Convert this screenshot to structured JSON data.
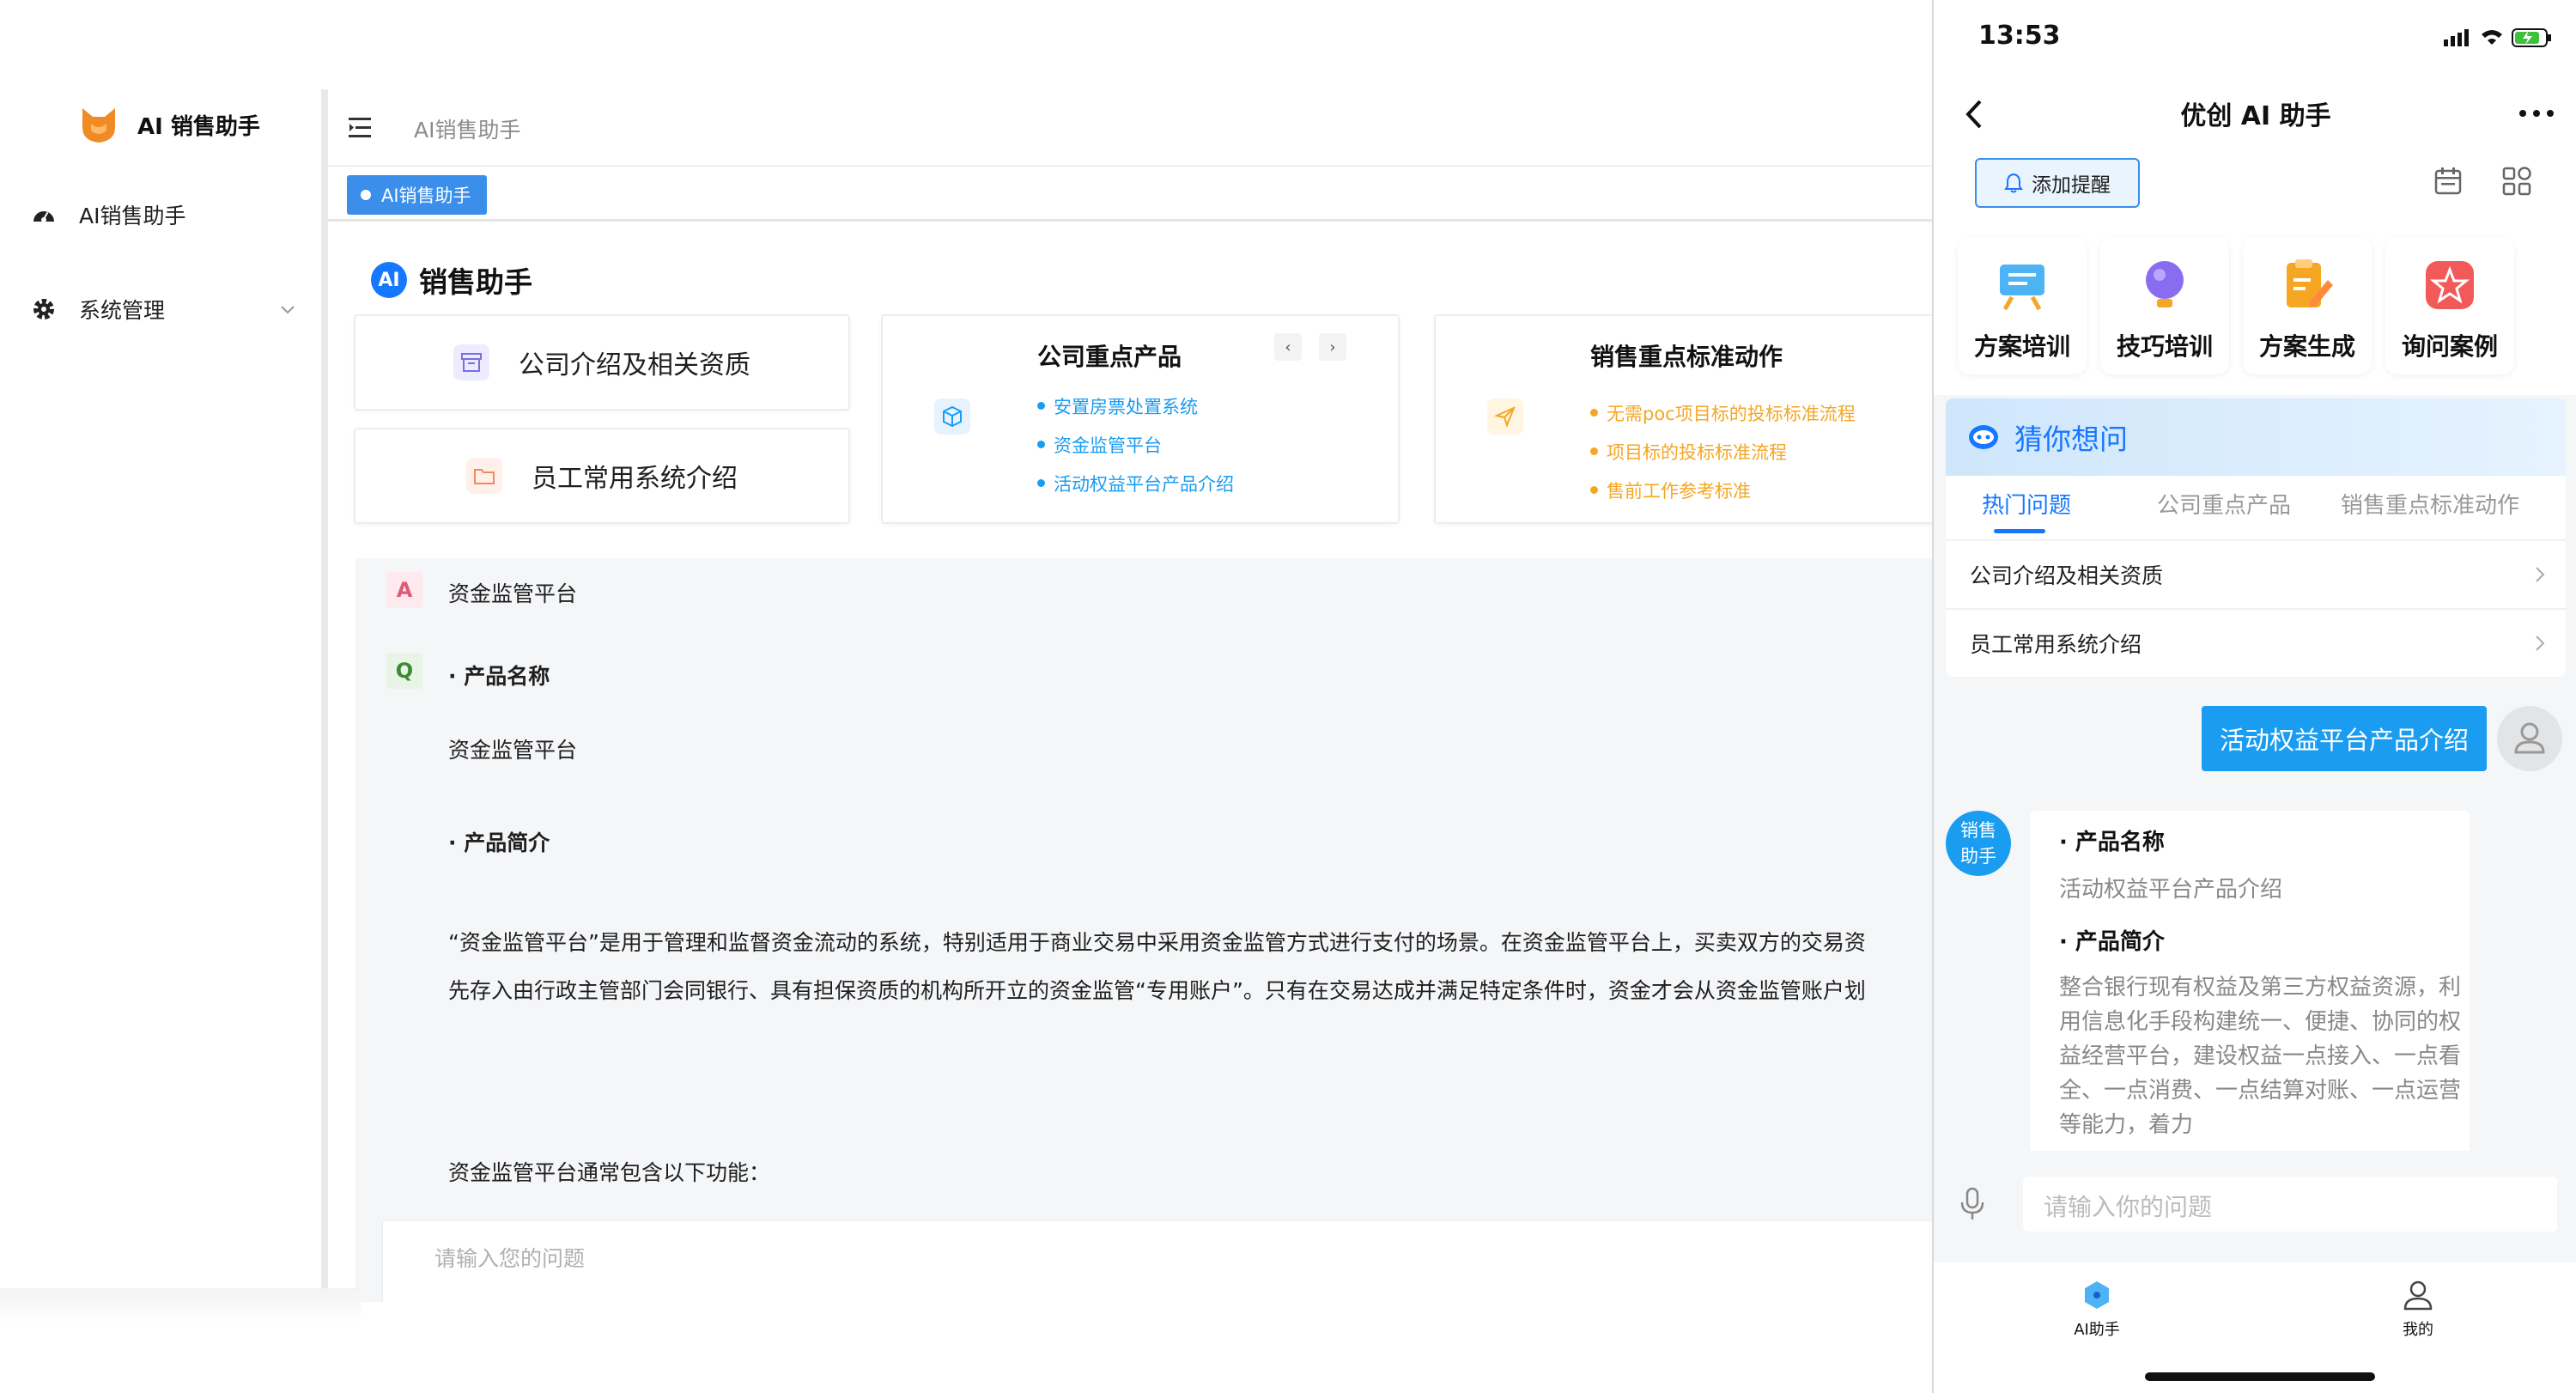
{
  "app": {
    "name": "AI 销售助手",
    "breadcrumb": "AI销售助手",
    "active_tab": "AI销售助手"
  },
  "sidebar": {
    "items": [
      {
        "label": "AI销售助手",
        "icon": "dashboard-icon"
      },
      {
        "label": "系统管理",
        "icon": "gear-icon",
        "expandable": true
      }
    ]
  },
  "main": {
    "title": "销售助手",
    "title_badge": "AI",
    "cards": {
      "company_intro": "公司介绍及相关资质",
      "employee_systems": "员工常用系统介绍",
      "key_products": {
        "title": "公司重点产品",
        "items": [
          "安置房票处置系统",
          "资金监管平台",
          "活动权益平台产品介绍"
        ]
      },
      "sales_actions": {
        "title": "销售重点标准动作",
        "items": [
          "无需poc项目标的投标标准流程",
          "项目标的投标标准流程",
          "售前工作参考标准"
        ]
      }
    },
    "chat": {
      "question_badge": "A",
      "question": "资金监管平台",
      "answer_badge": "Q",
      "answer": {
        "h1": "· 产品名称",
        "p1": "资金监管平台",
        "h2": "· 产品简介",
        "p2": "“资金监管平台”是用于管理和监督资金流动的系统，特别适用于商业交易中采用资金监管方式进行支付的场景。在资金监管平台上，买卖双方的交易资",
        "p3": "先存入由行政主管部门会同银行、具有担保资质的机构所开立的资金监管“专用账户”。只有在交易达成并满足特定条件时，资金才会从资金监管账户划",
        "p4": "资金监管平台通常包含以下功能："
      }
    },
    "input_placeholder": "请输入您的问题"
  },
  "phone": {
    "status_time": "13:53",
    "nav_title": "优创 AI 助手",
    "add_reminder": "添加提醒",
    "quick_actions": [
      "方案培训",
      "技巧培训",
      "方案生成",
      "询问案例"
    ],
    "guess": {
      "title": "猜你想问",
      "tabs": [
        "热门问题",
        "公司重点产品",
        "销售重点标准动作"
      ],
      "active_tab": 0,
      "items": [
        "公司介绍及相关资质",
        "员工常用系统介绍"
      ]
    },
    "user_message": "活动权益平台产品介绍",
    "bot_avatar_label": "销售助手",
    "bot_answer": {
      "h1": "· 产品名称",
      "p1": "活动权益平台产品介绍",
      "h2": "· 产品简介",
      "p2": "整合银行现有权益及第三方权益资源，利用信息化手段构建统一、便捷、协同的权益经营平台，建设权益一点接入、一点看全、一点消费、一点结算对账、一点运营等能力，着力"
    },
    "input_placeholder": "请输入你的问题",
    "bottom_nav": [
      "AI助手",
      "我的"
    ]
  },
  "colors": {
    "accent": "#1677ff",
    "tab_active": "#3b8eea",
    "bubble": "#1a9cf0",
    "product_bullet": "#1a9cf0",
    "action_bullet": "#f5a623"
  }
}
